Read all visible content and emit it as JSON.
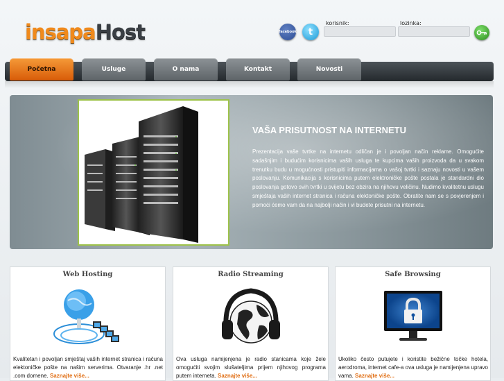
{
  "header": {
    "logo_left": "insapa",
    "logo_right": "Host",
    "social": {
      "facebook_text": "facebook",
      "twitter_text": "t"
    },
    "login": {
      "username_label": "korisnik:",
      "username_value": "",
      "password_label": "lozinka:",
      "password_value": ""
    }
  },
  "nav": {
    "items": [
      {
        "label": "Početna",
        "active": true
      },
      {
        "label": "Usluge",
        "active": false
      },
      {
        "label": "O nama",
        "active": false
      },
      {
        "label": "Kontakt",
        "active": false
      },
      {
        "label": "Novosti",
        "active": false
      }
    ]
  },
  "hero": {
    "title": "VAŠA PRISUTNOST NA INTERNETU",
    "text": "Prezentacija vaše tvrtke na internetu odličan je i povoljan način reklame. Omogućite sadašnjim i budućim korisnicima vaših usluga te kupcima vaših proizvoda da u svakom trenutku budu u mogućnosti pristupiti informacijama o vašoj tvrtki i saznaju novosti u vašem poslovanju. Komunikacija s korisnicima putem elektroničke pošte postala je standardni dio poslovanja gotovo svih tvrtki u svijetu bez obzira na njihovu veličinu. Nudimo kvalitetnu uslugu smještaja vaših internet stranica i računa elektoničke pošte. Obratite nam se s povjerenjem i pomoći ćemo vam da na najbolji način i vi budete prisutni na internetu."
  },
  "cards": [
    {
      "title": "Web Hosting",
      "text": "Kvalitetan i povoljan smještaj vaših internet stranica i računa elektoničke pošte na našim serverima. Otvaranje .hr .net .com domene.",
      "link": "Saznajte više..."
    },
    {
      "title": "Radio Streaming",
      "text": "Ova usluga namijenjena je radio stanicama koje žele omogućiti svojim slušateljima prijem njihovog programa putem interneta.",
      "link": "Saznajte više..."
    },
    {
      "title": "Safe Browsing",
      "text": "Ukoliko često putujete i koristite bežične točke hotela, aerodroma, internet cafe-a ova usluga je namijenjena upravo vama.",
      "link": "Saznajte više..."
    }
  ],
  "colors": {
    "accent_orange": "#f08a1c",
    "nav_dark": "#2f3539",
    "link_orange": "#e06d12",
    "hero_border_green": "#9ec34a"
  },
  "icons": [
    "facebook-icon",
    "twitter-icon",
    "login-go-icon",
    "server-rack-illustration",
    "globe-network-icon",
    "headphones-globe-icon",
    "padlock-monitor-icon"
  ]
}
